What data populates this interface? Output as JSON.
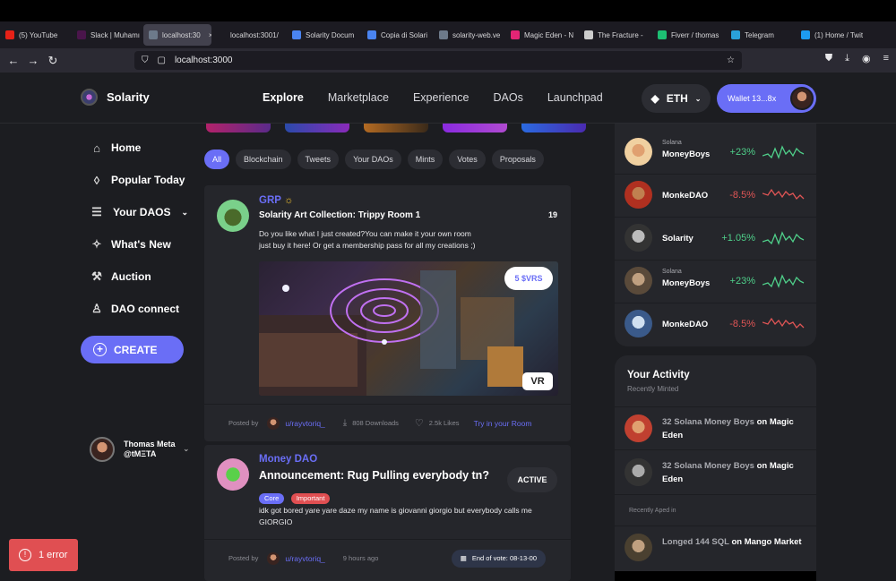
{
  "browser": {
    "tabs": [
      {
        "label": "(5) YouTube",
        "color": "#e62117"
      },
      {
        "label": "Slack | Muhamı",
        "color": "#4a154b"
      },
      {
        "label": "localhost:30",
        "color": "#6d7a8a",
        "active": true
      },
      {
        "label": "localhost:3001/",
        "color": "#1c1b22"
      },
      {
        "label": "Solarity Docum",
        "color": "#4a84f0"
      },
      {
        "label": "Copia di Solari",
        "color": "#4a84f0"
      },
      {
        "label": "solarity-web.ve",
        "color": "#6d7a8a"
      },
      {
        "label": "Magic Eden - N",
        "color": "#e42575"
      },
      {
        "label": "The Fracture -",
        "color": "#cccccc"
      },
      {
        "label": "Fiverr / thomas",
        "color": "#1dbf73"
      },
      {
        "label": "Telegram",
        "color": "#2aa1da"
      },
      {
        "label": "(1) Home / Twit",
        "color": "#1d9bf0"
      }
    ],
    "url": "localhost:3000"
  },
  "header": {
    "brand": "Solarity",
    "nav": [
      "Explore",
      "Marketplace",
      "Experience",
      "DAOs",
      "Launchpad"
    ],
    "eth_label": "ETH",
    "wallet_label": "Wallet 13...8x"
  },
  "sidebar": {
    "items": [
      {
        "label": "Home",
        "icon": "home-icon"
      },
      {
        "label": "Popular Today",
        "icon": "flame-icon"
      },
      {
        "label": "Your DAOS",
        "icon": "list-icon"
      },
      {
        "label": "What's New",
        "icon": "sparkle-icon"
      },
      {
        "label": "Auction",
        "icon": "gavel-icon"
      },
      {
        "label": "DAO connect",
        "icon": "user-icon"
      }
    ],
    "create_label": "CREATE",
    "profile_name": "Thomas Meta",
    "profile_handle": "@tMΞTA"
  },
  "filters": [
    "All",
    "Blockchain",
    "Tweets",
    "Your DAOs",
    "Mints",
    "Votes",
    "Proposals"
  ],
  "feed": [
    {
      "dao": "GRP",
      "title": "Solarity Art Collection: Trippy Room 1",
      "count": "19",
      "body_line1": "Do you like what I just created?You can make it your own room",
      "body_line2": "just buy it here! Or get a membership pass for all my creations ;)",
      "price": "5 $VRS",
      "vr": "VR",
      "posted_by": "Posted by",
      "user": "u/rayvtoriq_",
      "downloads": "808 Downloads",
      "likes": "2.5k Likes",
      "action": "Try in your Room"
    },
    {
      "dao": "Money DAO",
      "title": "Announcement: Rug Pulling everybody tn?",
      "status": "ACTIVE",
      "tags": [
        "Core",
        "Important"
      ],
      "body_line1": "idk got bored yare yare daze my name is giovanni giorgio but everybody calls me",
      "body_line2": "GIORGIO",
      "posted_by": "Posted by",
      "user": "u/rayvtoriq_",
      "time": "9 hours ago",
      "vote_end": "End of vote: 08-13-00"
    }
  ],
  "trending": [
    {
      "sub": "Solana",
      "name": "MoneyBoys",
      "change": "+23%",
      "dir": "up"
    },
    {
      "sub": "",
      "name": "MonkeDAO",
      "change": "-8.5%",
      "dir": "down"
    },
    {
      "sub": "",
      "name": "Solarity",
      "change": "+1.05%",
      "dir": "up"
    },
    {
      "sub": "Solana",
      "name": "MoneyBoys",
      "change": "+23%",
      "dir": "up"
    },
    {
      "sub": "",
      "name": "MonkeDAO",
      "change": "-8.5%",
      "dir": "down"
    }
  ],
  "activity": {
    "title": "Your Activity",
    "subtitle": "Recently Minted",
    "items": [
      {
        "qty": "32 Solana Money Boys",
        "on": "on",
        "market": "Magic Eden"
      },
      {
        "qty": "32 Solana Money Boys",
        "on": "on",
        "market": "Magic Eden"
      }
    ],
    "section2": "Recently Aped in",
    "aped": {
      "qty": "Longed 144 SQL",
      "on": "on",
      "market": "Mango Market"
    }
  },
  "error_label": "1 error",
  "colors": {
    "accent": "#6a6ef6",
    "up": "#4fd08a",
    "down": "#e05555"
  }
}
